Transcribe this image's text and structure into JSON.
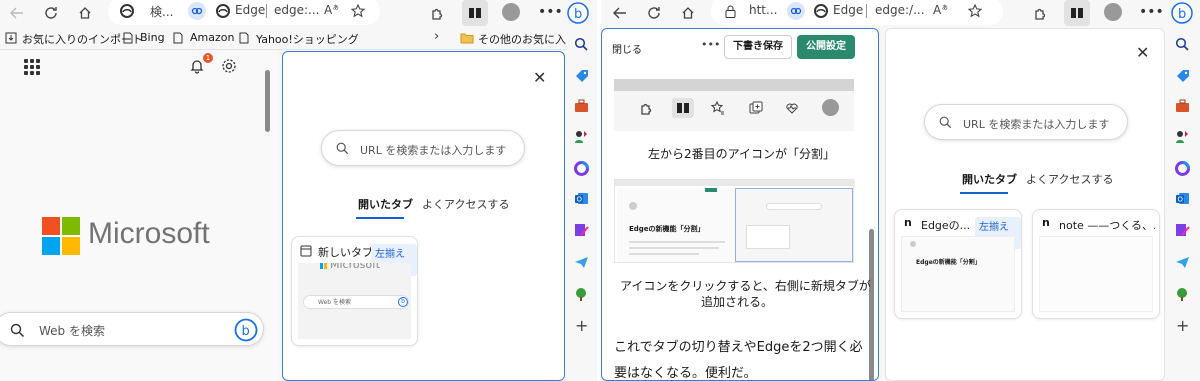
{
  "left_window": {
    "address": {
      "site_title": "検...",
      "tab_label": "Edge",
      "url": "edge:..."
    },
    "bookmarks": {
      "import": "お気に入りのインポート",
      "items": [
        "Bing",
        "Amazon",
        "Yahoo!ショッピング"
      ],
      "other": "その他のお気に入り"
    },
    "notification_count": "1",
    "brand": "Microsoft",
    "web_search_placeholder": "Web を検索",
    "split_pane": {
      "search_placeholder": "URL を検索または入力します",
      "tabs": [
        "開いたタブ",
        "よくアクセスする"
      ],
      "card": {
        "title": "新しいタブ",
        "badge": "左揃えタブ",
        "thumb_brand": "Microsoft",
        "thumb_search": "Web を検索"
      }
    }
  },
  "right_window": {
    "address": {
      "site_title": "htt...",
      "tab_label": "Edge",
      "url": "edge:/..."
    },
    "editor": {
      "close": "閉じる",
      "more": "•••",
      "save_draft": "下書き保存",
      "publish": "公開設定",
      "caption1": "左から2番目のアイコンが「分割」",
      "thumb_heading": "Edgeの新機能「分割」",
      "caption2a": "アイコンをクリックすると、右側に新規タブが",
      "caption2b": "追加される。",
      "body_line1": "これでタブの切り替えやEdgeを2つ開く必",
      "body_line2": "要はなくなる。便利だ。"
    },
    "split_pane": {
      "search_placeholder": "URL を検索または入力します",
      "tabs": [
        "開いたタブ",
        "よくアクセスする"
      ],
      "card1": {
        "title": "Edgeの...",
        "badge": "左揃えタブ",
        "thumb_heading": "Edgeの新機能「分割」"
      },
      "card2": {
        "title": "note ——つくる、..."
      }
    }
  },
  "colors": {
    "accent": "#1a5fd0",
    "publish_green": "#2b8a6e",
    "notification": "#e25a2b"
  }
}
